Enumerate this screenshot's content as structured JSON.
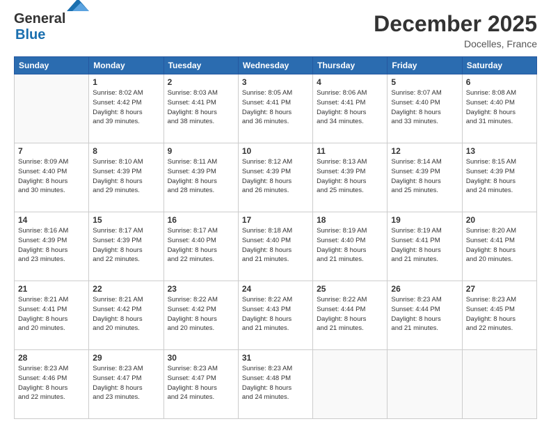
{
  "header": {
    "logo_general": "General",
    "logo_blue": "Blue",
    "month": "December 2025",
    "location": "Docelles, France"
  },
  "days_of_week": [
    "Sunday",
    "Monday",
    "Tuesday",
    "Wednesday",
    "Thursday",
    "Friday",
    "Saturday"
  ],
  "weeks": [
    [
      {
        "num": "",
        "info": ""
      },
      {
        "num": "1",
        "info": "Sunrise: 8:02 AM\nSunset: 4:42 PM\nDaylight: 8 hours\nand 39 minutes."
      },
      {
        "num": "2",
        "info": "Sunrise: 8:03 AM\nSunset: 4:41 PM\nDaylight: 8 hours\nand 38 minutes."
      },
      {
        "num": "3",
        "info": "Sunrise: 8:05 AM\nSunset: 4:41 PM\nDaylight: 8 hours\nand 36 minutes."
      },
      {
        "num": "4",
        "info": "Sunrise: 8:06 AM\nSunset: 4:41 PM\nDaylight: 8 hours\nand 34 minutes."
      },
      {
        "num": "5",
        "info": "Sunrise: 8:07 AM\nSunset: 4:40 PM\nDaylight: 8 hours\nand 33 minutes."
      },
      {
        "num": "6",
        "info": "Sunrise: 8:08 AM\nSunset: 4:40 PM\nDaylight: 8 hours\nand 31 minutes."
      }
    ],
    [
      {
        "num": "7",
        "info": "Sunrise: 8:09 AM\nSunset: 4:40 PM\nDaylight: 8 hours\nand 30 minutes."
      },
      {
        "num": "8",
        "info": "Sunrise: 8:10 AM\nSunset: 4:39 PM\nDaylight: 8 hours\nand 29 minutes."
      },
      {
        "num": "9",
        "info": "Sunrise: 8:11 AM\nSunset: 4:39 PM\nDaylight: 8 hours\nand 28 minutes."
      },
      {
        "num": "10",
        "info": "Sunrise: 8:12 AM\nSunset: 4:39 PM\nDaylight: 8 hours\nand 26 minutes."
      },
      {
        "num": "11",
        "info": "Sunrise: 8:13 AM\nSunset: 4:39 PM\nDaylight: 8 hours\nand 25 minutes."
      },
      {
        "num": "12",
        "info": "Sunrise: 8:14 AM\nSunset: 4:39 PM\nDaylight: 8 hours\nand 25 minutes."
      },
      {
        "num": "13",
        "info": "Sunrise: 8:15 AM\nSunset: 4:39 PM\nDaylight: 8 hours\nand 24 minutes."
      }
    ],
    [
      {
        "num": "14",
        "info": "Sunrise: 8:16 AM\nSunset: 4:39 PM\nDaylight: 8 hours\nand 23 minutes."
      },
      {
        "num": "15",
        "info": "Sunrise: 8:17 AM\nSunset: 4:39 PM\nDaylight: 8 hours\nand 22 minutes."
      },
      {
        "num": "16",
        "info": "Sunrise: 8:17 AM\nSunset: 4:40 PM\nDaylight: 8 hours\nand 22 minutes."
      },
      {
        "num": "17",
        "info": "Sunrise: 8:18 AM\nSunset: 4:40 PM\nDaylight: 8 hours\nand 21 minutes."
      },
      {
        "num": "18",
        "info": "Sunrise: 8:19 AM\nSunset: 4:40 PM\nDaylight: 8 hours\nand 21 minutes."
      },
      {
        "num": "19",
        "info": "Sunrise: 8:19 AM\nSunset: 4:41 PM\nDaylight: 8 hours\nand 21 minutes."
      },
      {
        "num": "20",
        "info": "Sunrise: 8:20 AM\nSunset: 4:41 PM\nDaylight: 8 hours\nand 20 minutes."
      }
    ],
    [
      {
        "num": "21",
        "info": "Sunrise: 8:21 AM\nSunset: 4:41 PM\nDaylight: 8 hours\nand 20 minutes."
      },
      {
        "num": "22",
        "info": "Sunrise: 8:21 AM\nSunset: 4:42 PM\nDaylight: 8 hours\nand 20 minutes."
      },
      {
        "num": "23",
        "info": "Sunrise: 8:22 AM\nSunset: 4:42 PM\nDaylight: 8 hours\nand 20 minutes."
      },
      {
        "num": "24",
        "info": "Sunrise: 8:22 AM\nSunset: 4:43 PM\nDaylight: 8 hours\nand 21 minutes."
      },
      {
        "num": "25",
        "info": "Sunrise: 8:22 AM\nSunset: 4:44 PM\nDaylight: 8 hours\nand 21 minutes."
      },
      {
        "num": "26",
        "info": "Sunrise: 8:23 AM\nSunset: 4:44 PM\nDaylight: 8 hours\nand 21 minutes."
      },
      {
        "num": "27",
        "info": "Sunrise: 8:23 AM\nSunset: 4:45 PM\nDaylight: 8 hours\nand 22 minutes."
      }
    ],
    [
      {
        "num": "28",
        "info": "Sunrise: 8:23 AM\nSunset: 4:46 PM\nDaylight: 8 hours\nand 22 minutes."
      },
      {
        "num": "29",
        "info": "Sunrise: 8:23 AM\nSunset: 4:47 PM\nDaylight: 8 hours\nand 23 minutes."
      },
      {
        "num": "30",
        "info": "Sunrise: 8:23 AM\nSunset: 4:47 PM\nDaylight: 8 hours\nand 24 minutes."
      },
      {
        "num": "31",
        "info": "Sunrise: 8:23 AM\nSunset: 4:48 PM\nDaylight: 8 hours\nand 24 minutes."
      },
      {
        "num": "",
        "info": ""
      },
      {
        "num": "",
        "info": ""
      },
      {
        "num": "",
        "info": ""
      }
    ]
  ]
}
